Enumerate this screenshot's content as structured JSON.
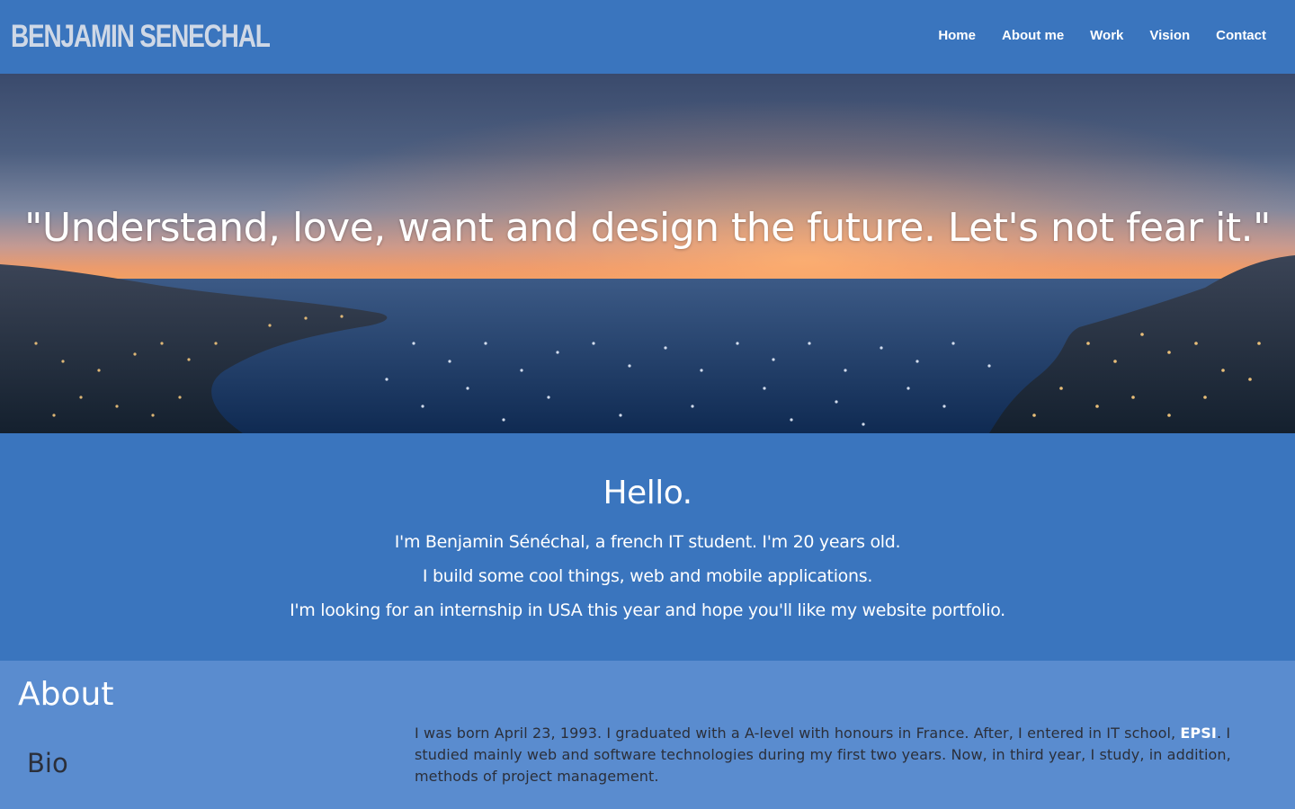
{
  "header": {
    "logo": "BENJAMIN SENECHAL",
    "nav": [
      "Home",
      "About me",
      "Work",
      "Vision",
      "Contact"
    ]
  },
  "hero": {
    "quote": "\"Understand, love, want and design the future. Let's not fear it.\""
  },
  "hello": {
    "title": "Hello.",
    "lines": [
      "I'm Benjamin Sénéchal, a french IT student. I'm 20 years old.",
      "I build some cool things, web and mobile applications.",
      "I'm looking for an internship in USA this year and hope you'll like my website portfolio."
    ]
  },
  "about": {
    "title": "About",
    "bio_title": "Bio",
    "bio_before": "I was born April 23, 1993. I graduated with a A-level with honours in France. After, I entered in IT school, ",
    "bio_link": "EPSI",
    "bio_after": ". I studied mainly web and software technologies during my first two years. Now, in third year, I study, in addition, methods of project management."
  },
  "colors": {
    "header_bg": "#3a75be",
    "about_bg": "#5a8ccf",
    "text_dark": "#2b2f3a"
  }
}
